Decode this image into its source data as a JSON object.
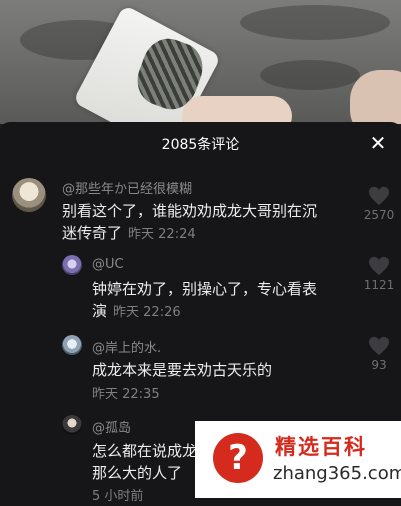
{
  "sheet": {
    "title": "2085条评论",
    "close_label": "✕"
  },
  "comments": [
    {
      "username": "@那些年か已经很模糊",
      "text_line1": "别看这个了，谁能劝劝成龙大哥别在沉",
      "text_line2": "迷传奇了",
      "time": "昨天 22:24",
      "likes": "2570"
    },
    {
      "username": "@UC",
      "text_line1": "钟婷在劝了，别操心了，专心看表",
      "text_line2": "演",
      "time": "昨天 22:26",
      "likes": "1121"
    },
    {
      "username": "@岸上的水.",
      "text_line1": "成龙本来是要去劝古天乐的",
      "time": "昨天 22:35",
      "likes": "93"
    },
    {
      "username": "@孤岛",
      "text_line1": "怎么都在说成龙",
      "text_line2": "那么大的人了",
      "time": "5 小时前"
    }
  ],
  "watermark": {
    "title": "精选百科",
    "url": "zhang365.com",
    "mark": "?"
  },
  "colors": {
    "sheet_bg": "#161618",
    "watermark_red": "#d42b1e"
  },
  "icons": [
    "close-icon",
    "heart-icon"
  ]
}
